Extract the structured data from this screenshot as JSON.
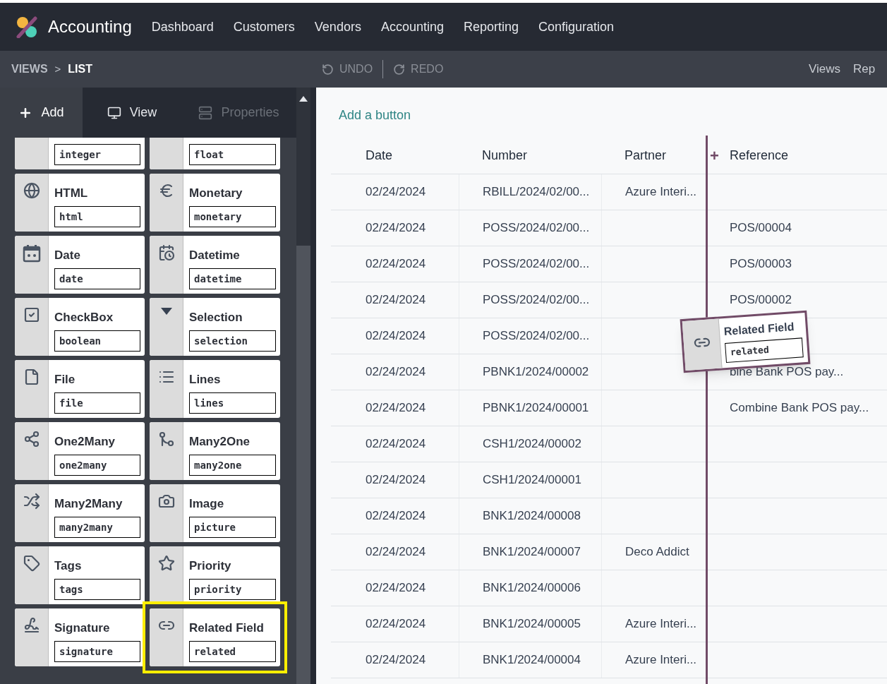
{
  "app": {
    "name": "Accounting",
    "menu": [
      "Dashboard",
      "Customers",
      "Vendors",
      "Accounting",
      "Reporting",
      "Configuration"
    ]
  },
  "breadcrumb": [
    {
      "label": "VIEWS",
      "current": false
    },
    {
      "label": "LIST",
      "current": true
    }
  ],
  "breadcrumb_separator": ">",
  "history": [
    {
      "kind": "undo",
      "label": "UNDO",
      "disabled": true
    },
    {
      "kind": "redo",
      "label": "REDO",
      "disabled": true
    }
  ],
  "top_tabs": [
    "Views",
    "Rep"
  ],
  "sidebar": {
    "tabs": [
      {
        "kind": "add",
        "label": "Add",
        "selected": true,
        "disabled": false
      },
      {
        "kind": "view",
        "label": "View",
        "selected": false,
        "disabled": false
      },
      {
        "kind": "properties",
        "label": "Properties",
        "selected": false,
        "disabled": true
      }
    ],
    "fields": [
      {
        "kind": "integer",
        "tag": "integer",
        "highlighted": false
      },
      {
        "kind": "float",
        "tag": "float",
        "highlighted": false
      },
      {
        "kind": "html",
        "label": "HTML",
        "tag": "html",
        "highlighted": false
      },
      {
        "kind": "monetary",
        "label": "Monetary",
        "tag": "monetary",
        "highlighted": false
      },
      {
        "kind": "date",
        "label": "Date",
        "tag": "date",
        "highlighted": false
      },
      {
        "kind": "datetime",
        "label": "Datetime",
        "tag": "datetime",
        "highlighted": false
      },
      {
        "kind": "boolean",
        "label": "CheckBox",
        "tag": "boolean",
        "highlighted": false
      },
      {
        "kind": "selection",
        "label": "Selection",
        "tag": "selection",
        "highlighted": false
      },
      {
        "kind": "file",
        "label": "File",
        "tag": "file",
        "highlighted": false
      },
      {
        "kind": "lines",
        "label": "Lines",
        "tag": "lines",
        "highlighted": false
      },
      {
        "kind": "one2many",
        "label": "One2Many",
        "tag": "one2many",
        "highlighted": false
      },
      {
        "kind": "many2one",
        "label": "Many2One",
        "tag": "many2one",
        "highlighted": false
      },
      {
        "kind": "many2many",
        "label": "Many2Many",
        "tag": "many2many",
        "highlighted": false
      },
      {
        "kind": "image",
        "label": "Image",
        "tag": "picture",
        "highlighted": false
      },
      {
        "kind": "tags",
        "label": "Tags",
        "tag": "tags",
        "highlighted": false
      },
      {
        "kind": "priority",
        "label": "Priority",
        "tag": "priority",
        "highlighted": false
      },
      {
        "kind": "signature",
        "label": "Signature",
        "tag": "signature",
        "highlighted": false
      },
      {
        "kind": "related",
        "label": "Related Field",
        "tag": "related",
        "highlighted": true
      }
    ]
  },
  "add_button": "Add a button",
  "table": {
    "columns": [
      "Date",
      "Number",
      "Partner",
      "Reference"
    ],
    "insert_marker": "+",
    "rows": [
      [
        "02/24/2024",
        "RBILL/2024/02/00...",
        "Azure Interi...",
        ""
      ],
      [
        "02/24/2024",
        "POSS/2024/02/00...",
        "",
        "POS/00004"
      ],
      [
        "02/24/2024",
        "POSS/2024/02/00...",
        "",
        "POS/00003"
      ],
      [
        "02/24/2024",
        "POSS/2024/02/00...",
        "",
        "POS/00002"
      ],
      [
        "02/24/2024",
        "POSS/2024/02/00...",
        "",
        ""
      ],
      [
        "02/24/2024",
        "PBNK1/2024/00002",
        "",
        "bine Bank POS pay..."
      ],
      [
        "02/24/2024",
        "PBNK1/2024/00001",
        "",
        "Combine Bank POS pay..."
      ],
      [
        "02/24/2024",
        "CSH1/2024/00002",
        "",
        ""
      ],
      [
        "02/24/2024",
        "CSH1/2024/00001",
        "",
        ""
      ],
      [
        "02/24/2024",
        "BNK1/2024/00008",
        "",
        ""
      ],
      [
        "02/24/2024",
        "BNK1/2024/00007",
        "Deco Addict",
        ""
      ],
      [
        "02/24/2024",
        "BNK1/2024/00006",
        "",
        ""
      ],
      [
        "02/24/2024",
        "BNK1/2024/00005",
        "Azure Interi...",
        ""
      ],
      [
        "02/24/2024",
        "BNK1/2024/00004",
        "Azure Interi...",
        ""
      ]
    ]
  },
  "drag_preview": {
    "kind": "related",
    "label": "Related Field",
    "tag": "related"
  }
}
